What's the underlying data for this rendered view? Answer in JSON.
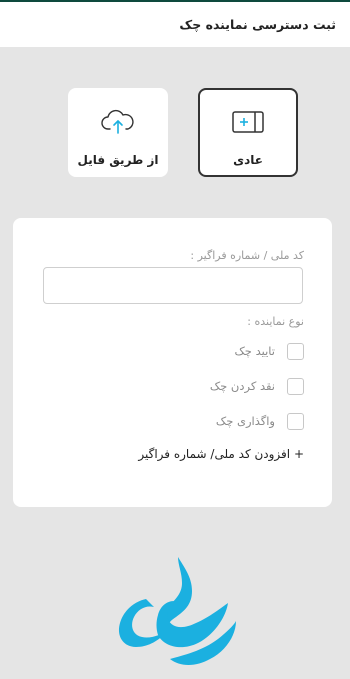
{
  "header": {
    "title": "ثبت دسترسی نماینده چک"
  },
  "type_buttons": {
    "normal_label": "عادی",
    "file_label": "از طریق فایل"
  },
  "form": {
    "id_label": "کد ملی / شماره فراگیر :",
    "id_value": "",
    "rep_type_label": "نوع نماینده :",
    "options": [
      {
        "label": "تایید چک",
        "checked": false
      },
      {
        "label": "نقد کردن چک",
        "checked": false
      },
      {
        "label": "واگذاری چک",
        "checked": false
      }
    ],
    "add_link": "+ افزودن کد ملی/ شماره فراگیر"
  },
  "colors": {
    "accent": "#1bb0e0",
    "header_line": "#0e4a3e",
    "background": "#e5e5e5"
  },
  "icons": {
    "normal": "check-card-plus-icon",
    "file": "cloud-upload-icon",
    "logo": "bank-logo-icon"
  }
}
